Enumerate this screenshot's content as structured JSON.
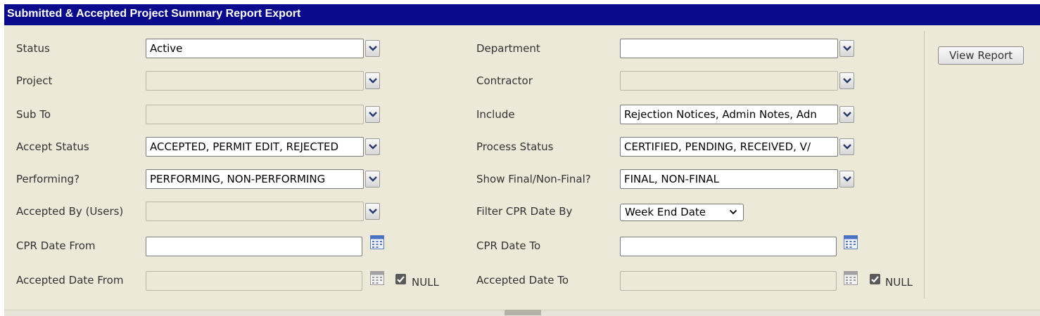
{
  "header": {
    "title": "Submitted & Accepted Project Summary Report Export"
  },
  "actions": {
    "view_report": "View Report"
  },
  "left": {
    "status": {
      "label": "Status",
      "value": "Active"
    },
    "project": {
      "label": "Project",
      "value": ""
    },
    "sub_to": {
      "label": "Sub To",
      "value": ""
    },
    "accept_status": {
      "label": "Accept Status",
      "value": "ACCEPTED, PERMIT EDIT, REJECTED"
    },
    "performing": {
      "label": "Performing?",
      "value": "PERFORMING, NON-PERFORMING"
    },
    "accepted_by": {
      "label": "Accepted By (Users)",
      "value": ""
    },
    "cpr_date_from": {
      "label": "CPR Date From",
      "value": ""
    },
    "accepted_date_from": {
      "label": "Accepted Date From",
      "value": "",
      "null_label": "NULL",
      "null_checked": true
    }
  },
  "right": {
    "department": {
      "label": "Department",
      "value": ""
    },
    "contractor": {
      "label": "Contractor",
      "value": ""
    },
    "include": {
      "label": "Include",
      "value": "Rejection Notices, Admin Notes, Adn"
    },
    "process_status": {
      "label": "Process Status",
      "value": "CERTIFIED, PENDING, RECEIVED, V/"
    },
    "show_final": {
      "label": "Show Final/Non-Final?",
      "value": "FINAL, NON-FINAL"
    },
    "filter_cpr_date_by": {
      "label": "Filter CPR Date By",
      "value": "Week End Date"
    },
    "cpr_date_to": {
      "label": "CPR Date To",
      "value": ""
    },
    "accepted_date_to": {
      "label": "Accepted Date To",
      "value": "",
      "null_label": "NULL",
      "null_checked": true
    }
  }
}
